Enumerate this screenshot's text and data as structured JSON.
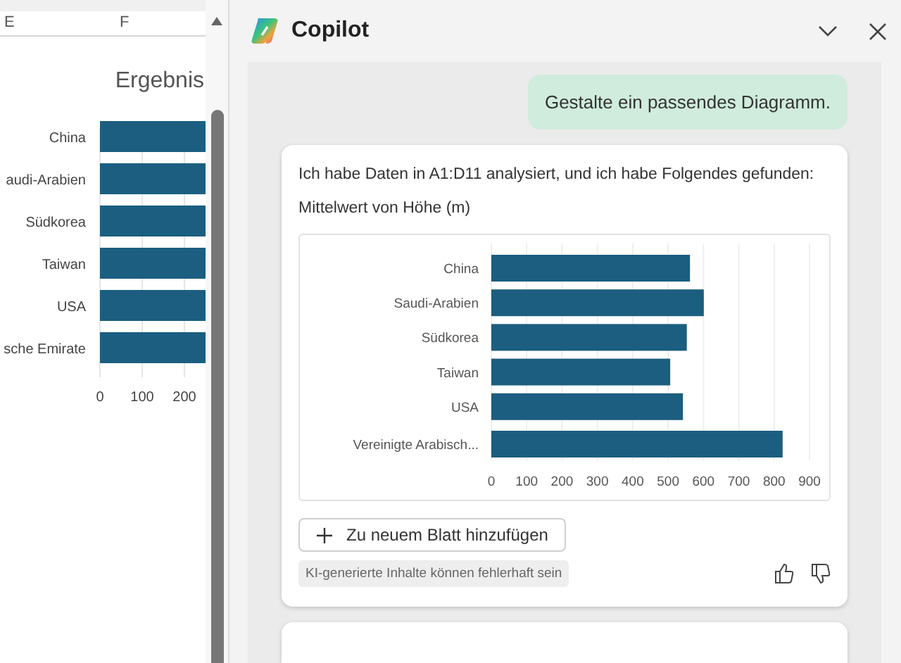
{
  "sheet": {
    "columns": [
      "E",
      "F"
    ],
    "chart": {
      "title": "Ergebnis",
      "categories": [
        "China",
        "audi-Arabien",
        "Südkorea",
        "Taiwan",
        "USA",
        "sche Emirate"
      ],
      "ticks": [
        "0",
        "100",
        "200"
      ]
    }
  },
  "copilot": {
    "title": "Copilot",
    "user_message": "Gestalte ein passendes Diagramm.",
    "response": {
      "intro": "Ich habe Daten in A1:D11 analysiert, und ich habe Folgendes gefunden:",
      "chart_title": "Mittelwert von Höhe (m)",
      "chart_data": {
        "type": "bar",
        "orientation": "horizontal",
        "grid": true,
        "categories": [
          "China",
          "Saudi-Arabien",
          "Südkorea",
          "Taiwan",
          "USA",
          "Vereinigte Arabisch..."
        ],
        "series": [
          {
            "color": "#1b5e80",
            "values": [
              562,
              601,
              553,
              506,
              542,
              824
            ]
          }
        ],
        "xlim": [
          0,
          900
        ],
        "xticks": [
          0,
          100,
          200,
          300,
          400,
          500,
          600,
          700,
          800,
          900
        ]
      },
      "add_button": "Zu neuem Blatt hinzufügen",
      "disclaimer": "KI-generierte Inhalte können fehlerhaft sein"
    }
  }
}
